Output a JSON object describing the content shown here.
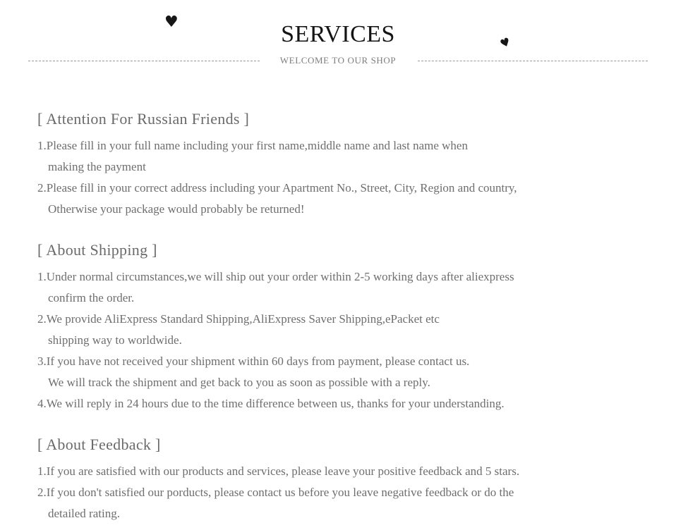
{
  "header": {
    "title": "SERVICES",
    "subtitle": "WELCOME TO OUR SHOP",
    "heart_glyph_left": "♥",
    "heart_glyph_right": "♥",
    "divider_style": "dashed",
    "title_color": "#141414",
    "subtitle_color": "#7d7d7d",
    "divider_color": "#9a9a9a"
  },
  "body": {
    "text_color": "#6e6e6e",
    "heading_color": "#6a6a6a",
    "background": "#ffffff"
  },
  "sections": [
    {
      "heading": "[ Attention For Russian Friends ]",
      "items": [
        {
          "lines": [
            "1.Please fill in your full name including your first name,middle name and last name when",
            "making the payment"
          ]
        },
        {
          "lines": [
            "2.Please fill in your correct address including your Apartment No., Street, City, Region and country,",
            "Otherwise your package would probably be returned!"
          ]
        }
      ]
    },
    {
      "heading": "[ About Shipping ]",
      "items": [
        {
          "lines": [
            "1.Under normal circumstances,we will ship out your order within 2-5 working days after aliexpress",
            "confirm the order."
          ]
        },
        {
          "lines": [
            "2.We provide AliExpress Standard Shipping,AliExpress Saver Shipping,ePacket etc",
            "shipping way to worldwide."
          ]
        },
        {
          "lines": [
            "3.If you have not received your shipment within 60 days from payment, please contact us.",
            "We will track the shipment and get back to you as soon as possible with a reply."
          ]
        },
        {
          "lines": [
            "4.We will reply in 24 hours due to the time difference between us, thanks for your understanding."
          ]
        }
      ]
    },
    {
      "heading": "[ About Feedback ]",
      "items": [
        {
          "lines": [
            "1.If you are satisfied with our products and services, please leave your positive feedback and 5 stars."
          ]
        },
        {
          "lines": [
            "2.If you don't satisfied our porducts, please contact us before you leave negative feedback or do the",
            "detailed rating."
          ]
        }
      ]
    }
  ]
}
